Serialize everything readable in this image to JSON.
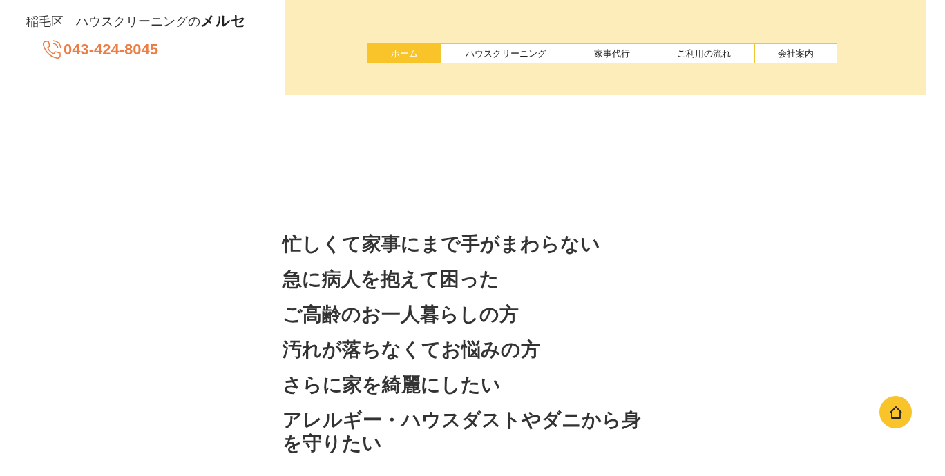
{
  "site_title": "稲毛区　ハウスクリーニングの**メルセ**",
  "phone": "043-424-8045",
  "nav": [
    {
      "label": "ホーム",
      "selected": true
    },
    {
      "label": "ハウスクリーニング",
      "selected": false
    },
    {
      "label": "家事代行",
      "selected": false
    },
    {
      "label": "ご利用の流れ",
      "selected": false
    },
    {
      "label": "会社案内",
      "selected": false
    }
  ],
  "concerns": [
    "忙しくて家事にまで手がまわらない",
    "急に病人を抱えて困った",
    "ご高齢のお一人暮らしの方",
    "汚れが落ちなくてお悩みの方",
    "さらに家を綺麗にしたい",
    "アレルギー・ハウスダストやダニから身を守りたい"
  ]
}
